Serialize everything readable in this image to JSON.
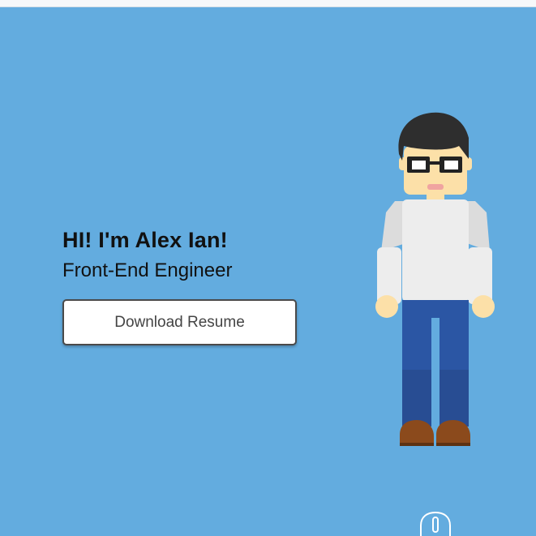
{
  "hero": {
    "greeting": "HI! I'm Alex Ian!",
    "role": "Front-End Engineer",
    "cta_label": "Download Resume"
  },
  "icons": {
    "avatar": "developer-avatar-illustration",
    "scroll": "mouse-scroll-icon"
  },
  "colors": {
    "background": "#63ACDF",
    "text": "#111111",
    "button_bg": "#FFFFFF",
    "button_border": "#4A4A4A",
    "shirt": "#EDEDED",
    "jeans": "#2B56A4",
    "hair": "#2E2E2E",
    "skin": "#FCE0A8",
    "shoes": "#8B4A1C"
  }
}
